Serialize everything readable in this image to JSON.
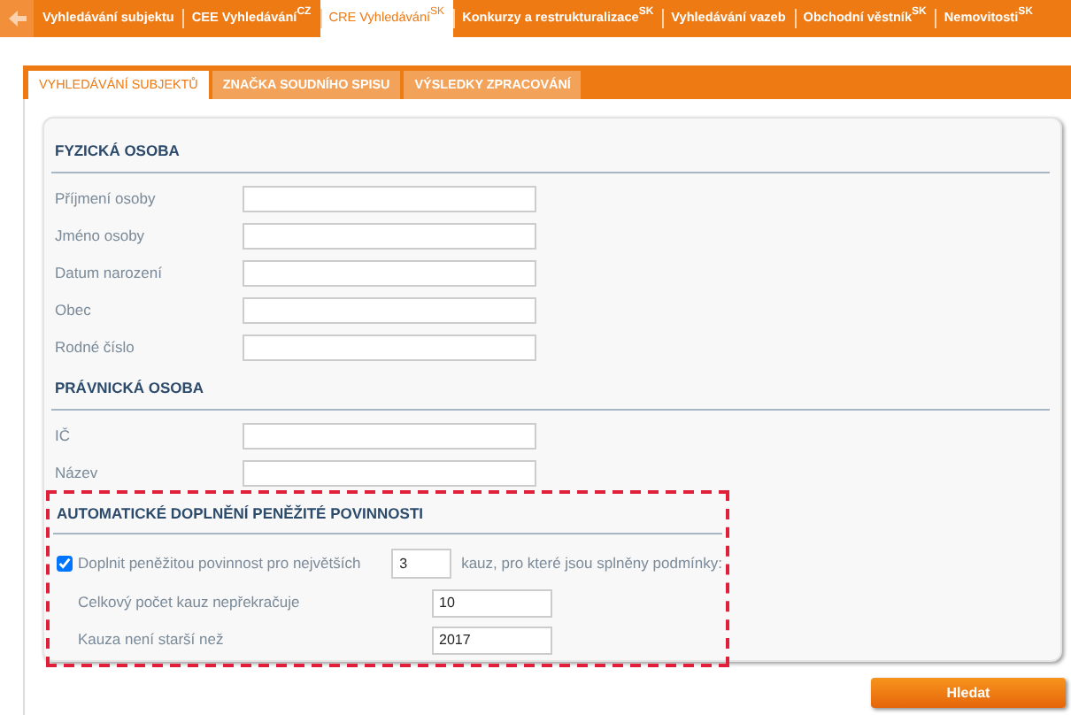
{
  "top_nav": [
    {
      "label": "Vyhledávání subjektu",
      "selected": false
    },
    {
      "label": "CEE Vyhledávání",
      "sup": "CZ",
      "selected": false
    },
    {
      "label": "CRE Vyhledávání",
      "sup": "SK",
      "selected": true
    },
    {
      "label": "Konkurzy a restrukturalizace",
      "sup": "SK",
      "selected": false
    },
    {
      "label": "Vyhledávání vazeb",
      "selected": false
    },
    {
      "label": "Obchodní věstník",
      "sup": "SK",
      "selected": false
    },
    {
      "label": "Nemovitosti",
      "sup": "SK",
      "selected": false
    }
  ],
  "sub_tabs": [
    {
      "label": "VYHLEDÁVÁNÍ SUBJEKTŮ",
      "selected": true
    },
    {
      "label": "ZNAČKA SOUDNÍHO SPISU",
      "selected": false
    },
    {
      "label": "VÝSLEDKY ZPRACOVÁNÍ",
      "selected": false
    }
  ],
  "sections": [
    {
      "title": "FYZICKÁ OSOBA",
      "fields": [
        {
          "label": "Příjmení osoby"
        },
        {
          "label": "Jméno osoby"
        },
        {
          "label": "Datum narození"
        },
        {
          "label": "Obec"
        },
        {
          "label": "Rodné číslo"
        }
      ]
    },
    {
      "title": "PRÁVNICKÁ OSOBA",
      "fields": [
        {
          "label": "IČ"
        },
        {
          "label": "Název"
        }
      ]
    }
  ],
  "auto_fill": {
    "title": "AUTOMATICKÉ DOPLNĚNÍ PENĚŽITÉ POVINNOSTI",
    "highlighted": true,
    "checked": true,
    "label": "Doplnit peněžitou povinnost pro největších",
    "count": "3",
    "suffix": "kauz, pro které jsou splněny podmínky:",
    "fields": [
      {
        "label": "Celkový počet kauz nepřekračuje",
        "value": "10"
      },
      {
        "label": "Kauza není starší než",
        "value": "2017"
      }
    ]
  },
  "search_button": "Hledat"
}
